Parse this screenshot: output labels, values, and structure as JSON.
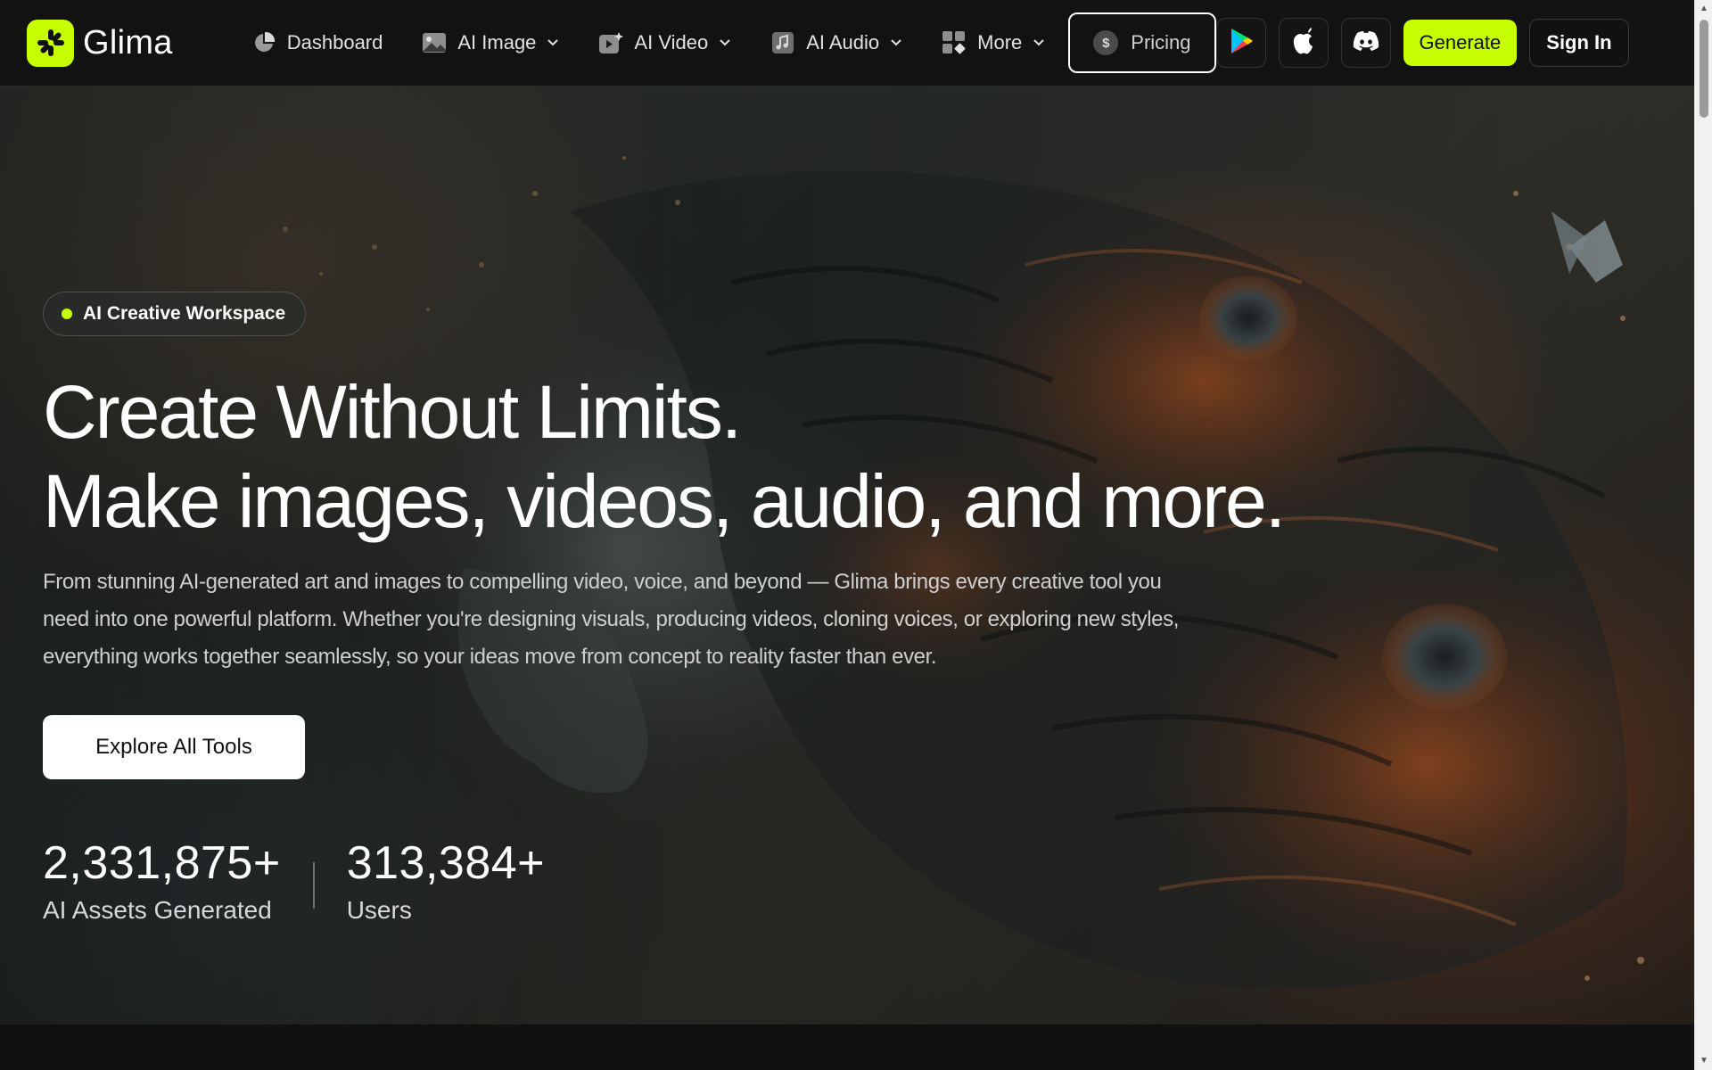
{
  "brand": {
    "name": "Glima",
    "accent_color": "#c6ff00"
  },
  "nav": {
    "items": [
      {
        "label": "Dashboard",
        "icon": "pie-chart-icon",
        "has_dropdown": false
      },
      {
        "label": "AI Image",
        "icon": "image-icon",
        "has_dropdown": true
      },
      {
        "label": "AI Video",
        "icon": "video-icon",
        "has_dropdown": true
      },
      {
        "label": "AI Audio",
        "icon": "music-icon",
        "has_dropdown": true
      },
      {
        "label": "More",
        "icon": "grid-icon",
        "has_dropdown": true
      }
    ],
    "pricing_label": "Pricing",
    "pricing_icon": "dollar-coin-icon",
    "app_buttons": [
      "google-play-icon",
      "apple-icon",
      "discord-icon"
    ],
    "generate_label": "Generate",
    "signin_label": "Sign In"
  },
  "hero": {
    "badge": "AI Creative Workspace",
    "headline_line1": "Create Without Limits.",
    "headline_line2": "Make images, videos, audio, and more.",
    "description": "From stunning AI-generated art and images to compelling video, voice, and beyond — Glima brings every creative tool you need into one powerful platform. Whether you're designing visuals, producing videos, cloning voices, or exploring new styles, everything works together seamlessly, so your ideas move from concept to reality faster than ever.",
    "cta_label": "Explore All Tools",
    "stats": [
      {
        "value": "2,331,875+",
        "label": "AI Assets Generated"
      },
      {
        "value": "313,384+",
        "label": "Users"
      }
    ]
  }
}
